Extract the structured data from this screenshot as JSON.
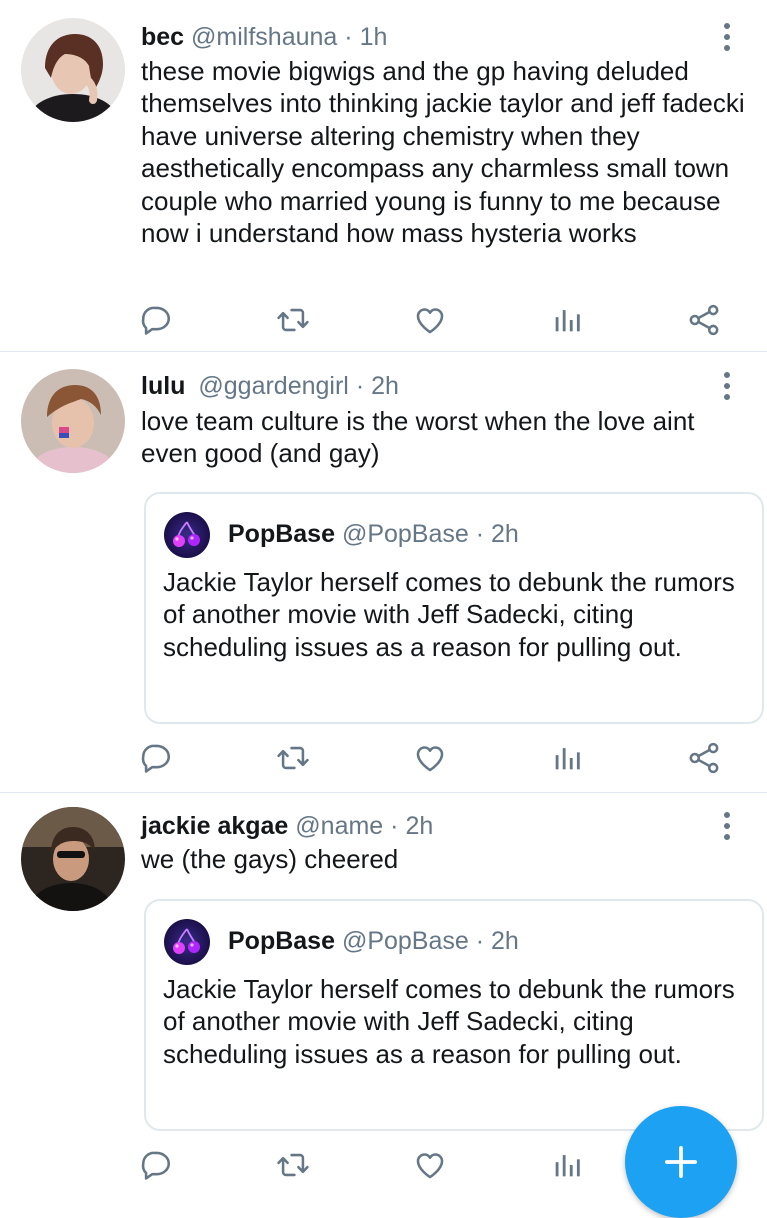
{
  "colors": {
    "text_primary": "#14171a",
    "text_secondary": "#657786",
    "divider": "#e1e8ed",
    "accent": "#1da1f2"
  },
  "tweets": [
    {
      "name": "bec",
      "handle": "@milfshauna",
      "separator": "·",
      "time": "1h",
      "text": "these movie bigwigs and the gp having deluded themselves into thinking jackie taylor and jeff fadecki have universe altering chemistry when they aesthetically encompass any charmless small town couple who married young is funny to me because now i understand how mass hysteria works"
    },
    {
      "name": "lulu",
      "handle": "@ggardengirl",
      "separator": "·",
      "time": "2h",
      "text": "love team culture is the worst when the love aint even good (and gay)",
      "quote": {
        "name": "PopBase",
        "handle": "@PopBase",
        "separator": "·",
        "time": "2h",
        "text": "Jackie Taylor herself comes to debunk the rumors of another movie with Jeff Sadecki, citing scheduling issues as a reason for pulling out."
      }
    },
    {
      "name": "jackie akgae",
      "handle": "@name",
      "separator": "·",
      "time": "2h",
      "text": "we (the gays) cheered",
      "quote": {
        "name": "PopBase",
        "handle": "@PopBase",
        "separator": "·",
        "time": "2h",
        "text": "Jackie Taylor herself comes to debunk the rumors of another movie with Jeff Sadecki, citing scheduling issues as a reason for pulling out."
      }
    }
  ],
  "action_icons": [
    "reply-icon",
    "retweet-icon",
    "like-icon",
    "analytics-icon",
    "share-icon"
  ],
  "compose_icon": "plus-icon"
}
